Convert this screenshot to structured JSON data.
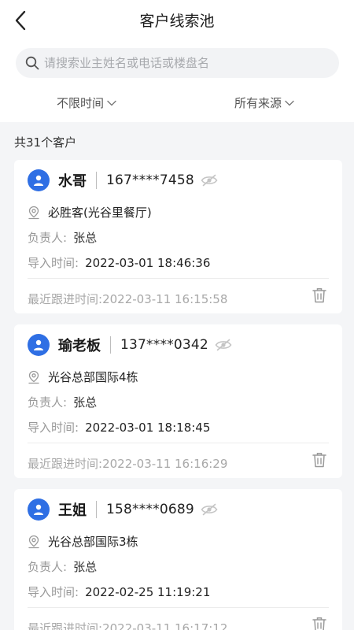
{
  "header": {
    "title": "客户线索池",
    "back_icon": "chevron-left-icon"
  },
  "search": {
    "placeholder": "请搜索业主姓名或电话或楼盘名",
    "value": ""
  },
  "filters": {
    "time_label": "不限时间",
    "source_label": "所有来源"
  },
  "summary": {
    "count_text": "共31个客户"
  },
  "labels": {
    "owner": "负责人:",
    "import_time": "导入时间:",
    "last_follow": "最近跟进时间:"
  },
  "customers": [
    {
      "name": "水哥",
      "phone": "167****7458",
      "address": "必胜客(光谷里餐厅)",
      "owner": "张总",
      "import_time": "2022-03-01 18:46:36",
      "last_follow": "2022-03-11 16:15:58"
    },
    {
      "name": "瑜老板",
      "phone": "137****0342",
      "address": "光谷总部国际4栋",
      "owner": "张总",
      "import_time": "2022-03-01 18:18:45",
      "last_follow": "2022-03-11 16:16:29"
    },
    {
      "name": "王姐",
      "phone": "158****0689",
      "address": "光谷总部国际3栋",
      "owner": "张总",
      "import_time": "2022-02-25 11:19:21",
      "last_follow": "2022-03-11 16:17:12"
    }
  ],
  "colors": {
    "accent": "#2f6fe4",
    "background": "#f4f5f7",
    "muted_text": "#999999"
  }
}
